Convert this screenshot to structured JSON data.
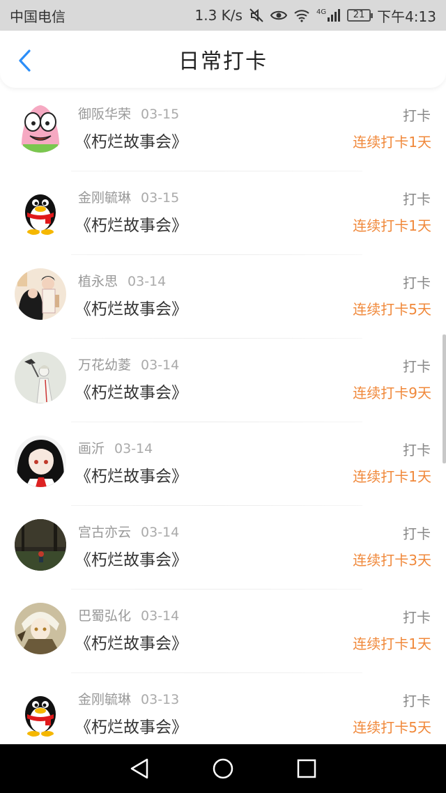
{
  "status_bar": {
    "carrier": "中国电信",
    "speed": "1.3 K/s",
    "network": "4G",
    "battery": "21",
    "time": "下午4:13",
    "icons": [
      "mute-icon",
      "eye-icon",
      "wifi-icon",
      "signal-icon",
      "battery-icon"
    ]
  },
  "header": {
    "title": "日常打卡",
    "back_icon": "chevron-left-icon"
  },
  "colors": {
    "accent": "#2c8ef8",
    "streak": "#f0883a",
    "statusbar_bg": "#d9d9d9"
  },
  "checkins": [
    {
      "user": "御阪华荣",
      "date": "03-15",
      "book": "《朽烂故事会》",
      "action": "打卡",
      "streak": "连续打卡1天",
      "avatar": "cartoon-starfish"
    },
    {
      "user": "金刚毓琳",
      "date": "03-15",
      "book": "《朽烂故事会》",
      "action": "打卡",
      "streak": "连续打卡1天",
      "avatar": "qq-penguin"
    },
    {
      "user": "植永思",
      "date": "03-14",
      "book": "《朽烂故事会》",
      "action": "打卡",
      "streak": "连续打卡5天",
      "avatar": "illustrated-couple"
    },
    {
      "user": "万花幼菱",
      "date": "03-14",
      "book": "《朽烂故事会》",
      "action": "打卡",
      "streak": "连续打卡9天",
      "avatar": "sketch-figure"
    },
    {
      "user": "画沂",
      "date": "03-14",
      "book": "《朽烂故事会》",
      "action": "打卡",
      "streak": "连续打卡1天",
      "avatar": "anime-girl"
    },
    {
      "user": "宫古亦云",
      "date": "03-14",
      "book": "《朽烂故事会》",
      "action": "打卡",
      "streak": "连续打卡3天",
      "avatar": "dark-forest"
    },
    {
      "user": "巴蜀弘化",
      "date": "03-14",
      "book": "《朽烂故事会》",
      "action": "打卡",
      "streak": "连续打卡1天",
      "avatar": "white-hair-anime"
    },
    {
      "user": "金刚毓琳",
      "date": "03-13",
      "book": "《朽烂故事会》",
      "action": "打卡",
      "streak": "连续打卡5天",
      "avatar": "qq-penguin"
    }
  ],
  "nav_bar": {
    "buttons": [
      "back-triangle-icon",
      "home-circle-icon",
      "recents-square-icon"
    ]
  }
}
